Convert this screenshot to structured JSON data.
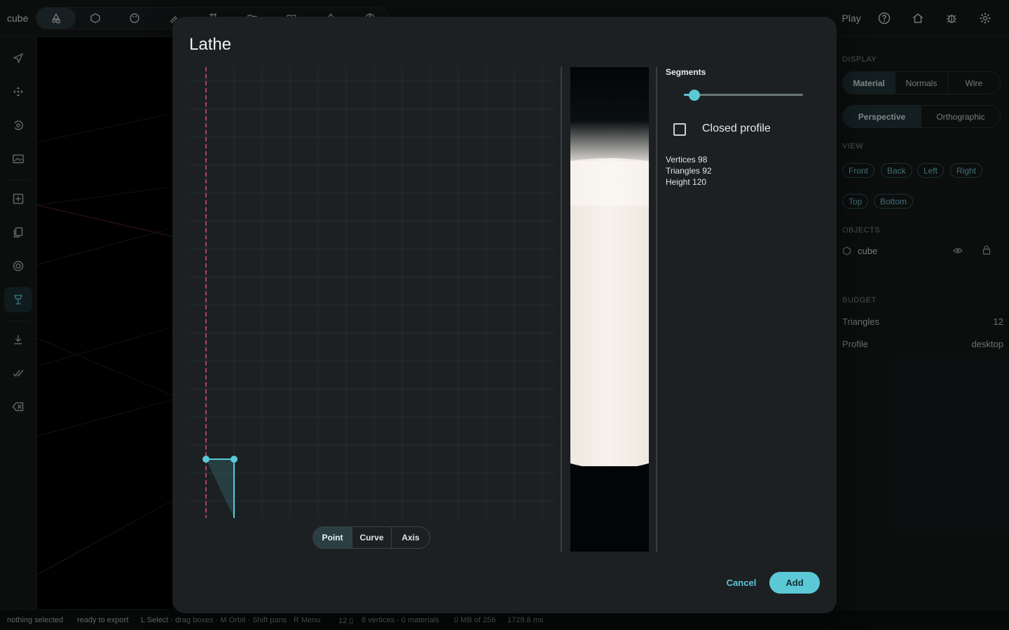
{
  "app": {
    "name": "cube"
  },
  "toolbar": {
    "tools": [
      {
        "icon": "shapes-icon",
        "active": true
      },
      {
        "icon": "hexagon-icon"
      },
      {
        "icon": "palette-icon"
      },
      {
        "icon": "brush-icon"
      },
      {
        "icon": "grid-icon"
      },
      {
        "icon": "folder-icon"
      },
      {
        "icon": "book-icon"
      },
      {
        "icon": "drop-icon"
      },
      {
        "icon": "globe-icon"
      }
    ],
    "play_label": "Play"
  },
  "sidebar": {
    "items": [
      {
        "icon": "send-icon"
      },
      {
        "icon": "move-icon"
      },
      {
        "icon": "rotate-icon"
      },
      {
        "icon": "image-icon"
      },
      {
        "icon": "add-box-icon"
      },
      {
        "icon": "copy-icon"
      },
      {
        "icon": "target-icon"
      },
      {
        "icon": "lathe-icon",
        "active": true
      },
      {
        "icon": "download-icon"
      },
      {
        "icon": "checks-icon"
      },
      {
        "icon": "backspace-icon"
      }
    ]
  },
  "right_panel": {
    "display_title": "DISPLAY",
    "display_modes": [
      "Material",
      "Normals",
      "Wire"
    ],
    "display_active": "Material",
    "projection_modes": [
      "Perspective",
      "Orthographic"
    ],
    "projection_active": "Perspective",
    "view_title": "VIEW",
    "view_buttons": [
      "Front",
      "Back",
      "Left",
      "Right",
      "Top",
      "Bottom"
    ],
    "objects_title": "OBJECTS",
    "object_name": "cube",
    "budget_title": "BUDGET",
    "budget": [
      {
        "label": "Triangles",
        "value": "12"
      },
      {
        "label": "Profile",
        "value": "desktop"
      }
    ]
  },
  "dialog": {
    "title": "Lathe",
    "modes": [
      "Point",
      "Curve",
      "Axis"
    ],
    "mode_active": "Point",
    "segments_label": "Segments",
    "segments_slider_fraction": 0.09,
    "closed_profile_label": "Closed profile",
    "closed_profile_checked": false,
    "stats": [
      "Vertices 98",
      "Triangles 92",
      "Height 120"
    ],
    "cancel_label": "Cancel",
    "add_label": "Add"
  },
  "status": {
    "items": [
      "nothing selected",
      "ready to export",
      "L Select · drag boxes · M Orbit · Shift pans · R Menu",
      "12 ▯",
      "8 vertices · 0 materials",
      "0 MB of 256",
      "1729.8 ms"
    ]
  },
  "colors": {
    "accent": "#5bc8d6",
    "axis_line": "#e0506e",
    "panel": "#1c2022"
  }
}
